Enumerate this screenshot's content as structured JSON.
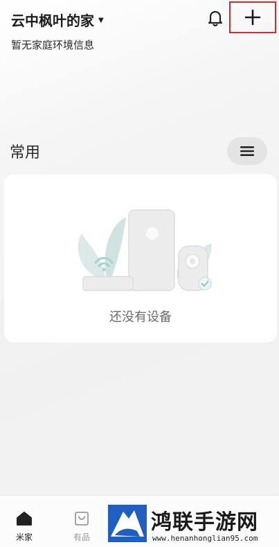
{
  "header": {
    "home_name": "云中枫叶的家",
    "caret_glyph": "▼",
    "env_info": "暂无家庭环境信息",
    "bell_icon": "bell-icon",
    "add_icon": "plus-icon",
    "highlight_color": "#d12a2a"
  },
  "section": {
    "title": "常用",
    "menu_icon": "hamburger-menu-icon"
  },
  "empty_state": {
    "message": "还没有设备",
    "illustration": "devices-placeholder-illustration"
  },
  "tabbar": {
    "tabs": [
      {
        "label": "米家",
        "icon": "home-icon",
        "active": true
      },
      {
        "label": "有品",
        "icon": "shopping-bag-icon",
        "active": false
      }
    ]
  },
  "watermark": {
    "title": "鸿联手游网",
    "url": "www.henanhonglian95.com"
  },
  "colors": {
    "background": "#f3f3f3",
    "card": "#ffffff",
    "accent_blue": "#1f5fc2",
    "text_primary": "#1c1c1c",
    "text_secondary": "#6a6a6a"
  }
}
